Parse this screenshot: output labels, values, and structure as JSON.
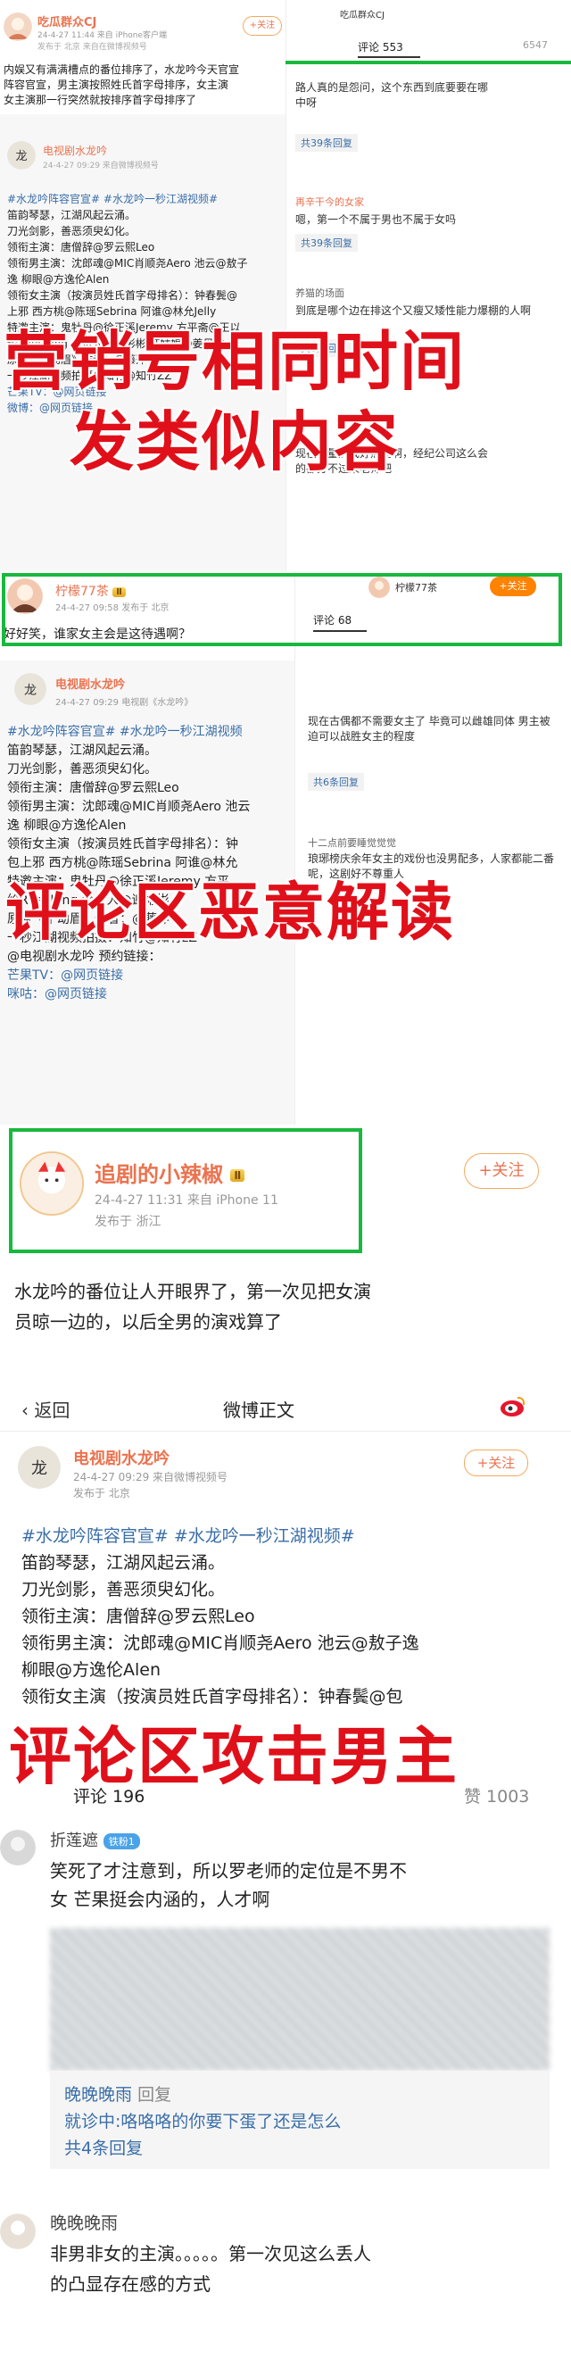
{
  "overlays": {
    "marketing": [
      "营销号相同时间",
      "发类似内容"
    ],
    "malicious": "评论区恶意解读",
    "attack": "评论区攻击男主"
  },
  "section1": {
    "account": "吃瓜群众CJ",
    "meta": "24-4-27 11:44  来自 iPhone客户端",
    "meta2": "发布于 北京  来自在微博视频号",
    "follow": "+关注",
    "intro_lines": [
      "内娱又有满满槽点的番位排序了，水龙吟今天官宣",
      "阵容官宣，男主演按照姓氏首字母排序，女主演",
      "女主演那一行突然就按排序首字母排序了"
    ],
    "repost_account": "电视剧水龙吟",
    "repost_meta": "24-4-27 09:29  来自微博视频号",
    "repost_lines": [
      "#水龙吟阵容官宣# #水龙吟一秒江湖视频#",
      "笛韵琴瑟，江湖风起云涌。",
      "刀光剑影，善恶须臾幻化。",
      "领衔主演：唐僧辞@罗云熙Leo",
      "领衔男主演：沈郎魂@MIC肖顺尧Aero 池云@敖子",
      "逸 柳眼@方逸伦Alen",
      "领衔女主演（按演员姓氏首字母排名）：钟春鬓@",
      "上邪 西方桃@陈瑶Sebrina 阿谁@林允Jelly",
      "特邀主演：鬼牡丹@徐正溪Jeremy 方平斋@王以",
      "纶RileyKing 余负人@谢彬彬 红姑娘@姜贝尔",
      "原著《千劫眉》作者：@藤萍",
      "一秒江湖视频拍摄：知竹@知竹ZZ",
      "芒果TV：@网页链接",
      "微博：@网页链接"
    ],
    "comments_tab": "评论",
    "comments_count": "553",
    "likes_count": "6547",
    "comments": [
      {
        "text": "路人真的是怨问，这个东西到底要要在哪",
        "extra": "中呀"
      },
      {
        "name": "再辛干今的女家",
        "text": "嗯，第一个不属于男也不属于女吗",
        "replies": "共39条回复"
      },
      {
        "name": "养猫的场面",
        "text": "到底是哪个边在排这个又瘦又矮性能力爆棚的人啊",
        "replies": "共6条回复"
      },
      {
        "text": "现在流量演戏好热闹啊，经纪公司这么会",
        "extra": "的都分不过来老师吧"
      }
    ]
  },
  "section2": {
    "account": "柠檬77茶",
    "meta": "24-4-27 09:58  发布于 北京",
    "post": "好好笑，谁家女主会是这待遇啊？",
    "repost_account": "电视剧水龙吟",
    "repost_meta": "24-4-27 09:29  电视剧《水龙吟》",
    "repost_lines": [
      "#水龙吟阵容官宣# #水龙吟一秒江湖视频",
      "笛韵琴瑟，江湖风起云涌。",
      "刀光剑影，善恶须臾幻化。",
      "领衔主演：唐僧辞@罗云熙Leo",
      "领衔男主演：沈郎魂@MIC肖顺尧Aero 池云",
      "逸 柳眼@方逸伦Alen",
      "领衔女主演（按演员姓氏首字母排名）：钟",
      "包上邪 西方桃@陈瑶Sebrina 阿谁@林允",
      "特邀主演：鬼牡丹@徐正溪Jeremy 方平",
      "纶RileyKing 余负人@谢彬彬",
      "原著《千劫眉》作者：@藤萍",
      "一秒江湖视频拍摄：知竹@知竹zZ",
      "@电视剧水龙吟 预约链接：",
      "芒果TV：@网页链接",
      "咪咕：@网页链接"
    ],
    "comments_tab": "评论",
    "comments_count": "68",
    "comments": [
      {
        "text": "现在古偶都不需要女主了 毕竟可以雌雄同体 男主被迫可以战胜女主的程度",
        "replies": "共6条回复"
      },
      {
        "name": "十二点前要睡觉觉觉",
        "text": "琅琊榜庆余年女主的戏份也没男配多，人家都能二番呢，这剧好不尊重人"
      }
    ],
    "follow": "+关注"
  },
  "section3": {
    "account": "追剧的小辣椒",
    "meta": "24-4-27 11:31  来自 iPhone 11",
    "meta2": "发布于 浙江",
    "follow": "+关注",
    "post_lines": [
      "水龙吟的番位让人开眼界了，第一次见把女演",
      "员晾一边的，以后全男的演戏算了"
    ],
    "nav_back": "返回",
    "nav_title": "微博正文",
    "repost_account": "电视剧水龙吟",
    "repost_meta": "24-4-27 09:29  来自微博视频号",
    "repost_meta2": "发布于 北京",
    "repost_follow": "+关注",
    "repost_lines": [
      "#水龙吟阵容官宣# #水龙吟一秒江湖视频#",
      "笛韵琴瑟，江湖风起云涌。",
      "刀光剑影，善恶须臾幻化。",
      "领衔主演：唐僧辞@罗云熙Leo",
      "领衔男主演：沈郎魂@MIC肖顺尧Aero 池云@敖子逸",
      "柳眼@方逸伦Alen",
      "领衔女主演（按演员姓氏首字母排名）：钟春鬓@包"
    ],
    "tabs": {
      "comments": "评论 196",
      "likes": "赞 1003"
    },
    "comment1": {
      "name": "折莲遮",
      "badge": "铁粉1",
      "lines": [
        "笑死了才注意到，所以罗老师的定位是不男不",
        "女 芒果挺会内涵的，人才啊"
      ],
      "reply_name": "晚晚晚雨",
      "reply_tag": "回复",
      "reply_text": "就诊中:咯咯咯的你要下蛋了还是怎么",
      "replies": "共4条回复"
    },
    "comment2": {
      "name": "晚晚晚雨",
      "lines": [
        "非男非女的主演。。。。。第一次见这么丢人",
        "的凸显存在感的方式"
      ]
    }
  },
  "colors": {
    "overlay": "#e0101a",
    "frame": "#19b83e",
    "link": "#3a6ea8",
    "accent": "#eb7350"
  }
}
